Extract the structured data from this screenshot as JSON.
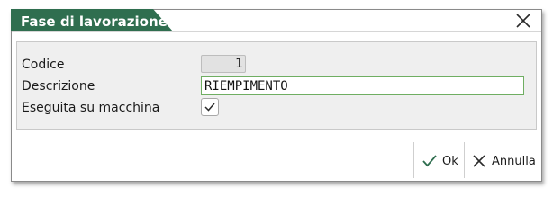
{
  "dialog": {
    "title": "Fase di lavorazione",
    "accent_color": "#2f6e4f",
    "close_icon": "close-icon"
  },
  "form": {
    "code_label": "Codice",
    "code_value": "1",
    "description_label": "Descrizione",
    "description_value": "RIEMPIMENTO",
    "machine_label": "Eseguita su macchina",
    "machine_checked": true
  },
  "footer": {
    "ok_label": "Ok",
    "ok_icon": "check-icon",
    "cancel_label": "Annulla",
    "cancel_icon": "cancel-icon"
  }
}
